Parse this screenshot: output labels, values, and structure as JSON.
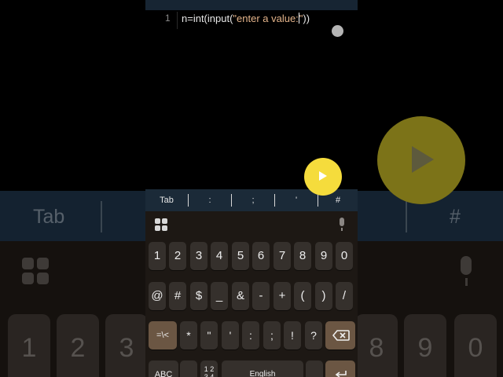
{
  "editor": {
    "line_number": "1",
    "code_prefix": "n=int(input(",
    "code_string": "\"enter a value:",
    "code_after_cursor": "\"",
    "code_suffix": "))"
  },
  "symbol_bar": {
    "items": [
      "Tab",
      ":",
      ";",
      "'",
      "#"
    ]
  },
  "keyboard": {
    "row_numbers": [
      "1",
      "2",
      "3",
      "4",
      "5",
      "6",
      "7",
      "8",
      "9",
      "0"
    ],
    "row_symbols": [
      "@",
      "#",
      "$",
      "_",
      "&",
      "-",
      "+",
      "(",
      ")",
      "/"
    ],
    "row_punct": [
      "=\\<",
      "*",
      "\"",
      "'",
      ":",
      ";",
      "!",
      "?"
    ],
    "abc_label": "ABC",
    "num_toggle_label": "1 2\n3 4",
    "space_label": "English"
  },
  "background_blur": {
    "tab_label": "Tab",
    "hash_label": "#",
    "keys": [
      "1",
      "2",
      "3",
      "8",
      "9",
      "0"
    ]
  },
  "colors": {
    "run_button": "#f5dc3c",
    "symbol_bar": "#1b2a38",
    "keyboard_bg": "#1d1814",
    "key_bg": "#35302c",
    "accent_key_bg": "#6b5643"
  }
}
